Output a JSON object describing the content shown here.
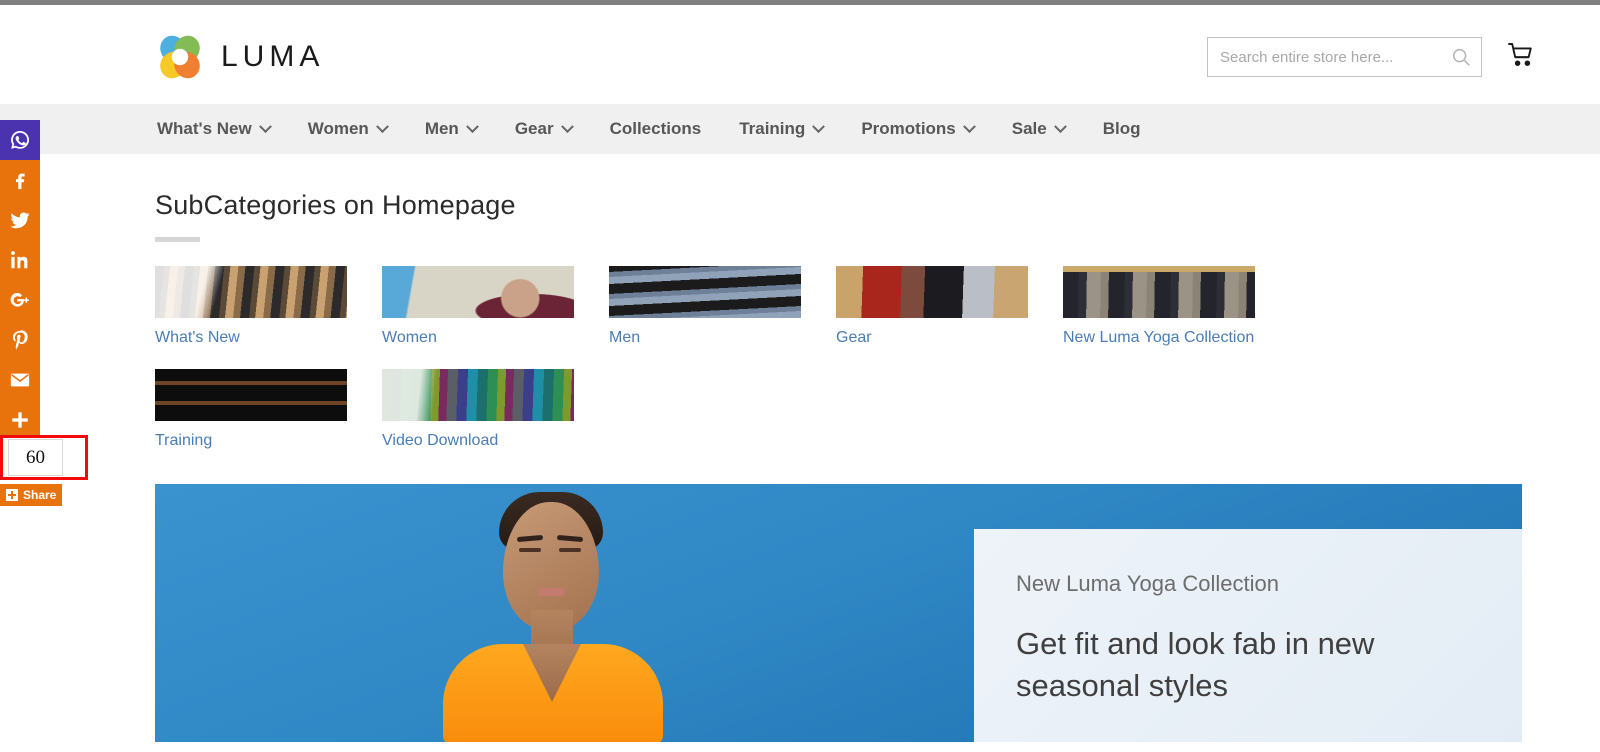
{
  "brand": {
    "name": "LUMA",
    "logo_icon": "luma-flower-logo",
    "logo_colors": [
      "#3fa9dd",
      "#7ab648",
      "#f6c517",
      "#ef7622"
    ]
  },
  "header": {
    "search": {
      "placeholder": "Search entire store here...",
      "value": "",
      "icon": "search-icon"
    },
    "cart": {
      "icon": "shopping-cart-icon",
      "count": ""
    }
  },
  "nav": {
    "items": [
      {
        "label": "What's New",
        "has_dropdown": true
      },
      {
        "label": "Women",
        "has_dropdown": true
      },
      {
        "label": "Men",
        "has_dropdown": true
      },
      {
        "label": "Gear",
        "has_dropdown": true
      },
      {
        "label": "Collections",
        "has_dropdown": false
      },
      {
        "label": "Training",
        "has_dropdown": true
      },
      {
        "label": "Promotions",
        "has_dropdown": true
      },
      {
        "label": "Sale",
        "has_dropdown": true
      },
      {
        "label": "Blog",
        "has_dropdown": false
      }
    ]
  },
  "main": {
    "page_title": "SubCategories on Homepage",
    "tiles": [
      {
        "label": "What's New",
        "image": "clothing-rack-photo",
        "style": "ph-whatsnew"
      },
      {
        "label": "Women",
        "image": "woman-sunglasses-photo",
        "style": "ph-women"
      },
      {
        "label": "Men",
        "image": "folded-jeans-photo",
        "style": "ph-men"
      },
      {
        "label": "Gear",
        "image": "folded-shirts-table-photo",
        "style": "ph-gear"
      },
      {
        "label": "New Luma Yoga Collection",
        "image": "hanging-jackets-photo",
        "style": "ph-yoga"
      },
      {
        "label": "Training",
        "image": "shelved-clothes-photo",
        "style": "ph-training"
      },
      {
        "label": "Video Download",
        "image": "colorful-scarves-photo",
        "style": "ph-video"
      }
    ]
  },
  "hero": {
    "eyebrow": "New Luma Yoga Collection",
    "headline": "Get fit and look fab in new seasonal styles",
    "background_color": "#2f87c4",
    "card_color": "#e9f0f7",
    "image": "woman-meditating-orange-shirt-photo"
  },
  "share_rail": {
    "buttons": [
      {
        "name": "whatsapp",
        "label": "WhatsApp",
        "color": "#4b33b0"
      },
      {
        "name": "facebook",
        "label": "Facebook",
        "color": "#e8730c"
      },
      {
        "name": "twitter",
        "label": "Twitter",
        "color": "#e8730c"
      },
      {
        "name": "linkedin",
        "label": "LinkedIn",
        "color": "#e8730c"
      },
      {
        "name": "googleplus",
        "label": "Google Plus",
        "color": "#e8730c"
      },
      {
        "name": "pinterest",
        "label": "Pinterest",
        "color": "#e8730c"
      },
      {
        "name": "email",
        "label": "Email",
        "color": "#e8730c"
      },
      {
        "name": "more",
        "label": "More",
        "color": "#e8730c"
      }
    ],
    "count": "60",
    "share_label": "Share",
    "highlight_color": "#f40a0a"
  }
}
